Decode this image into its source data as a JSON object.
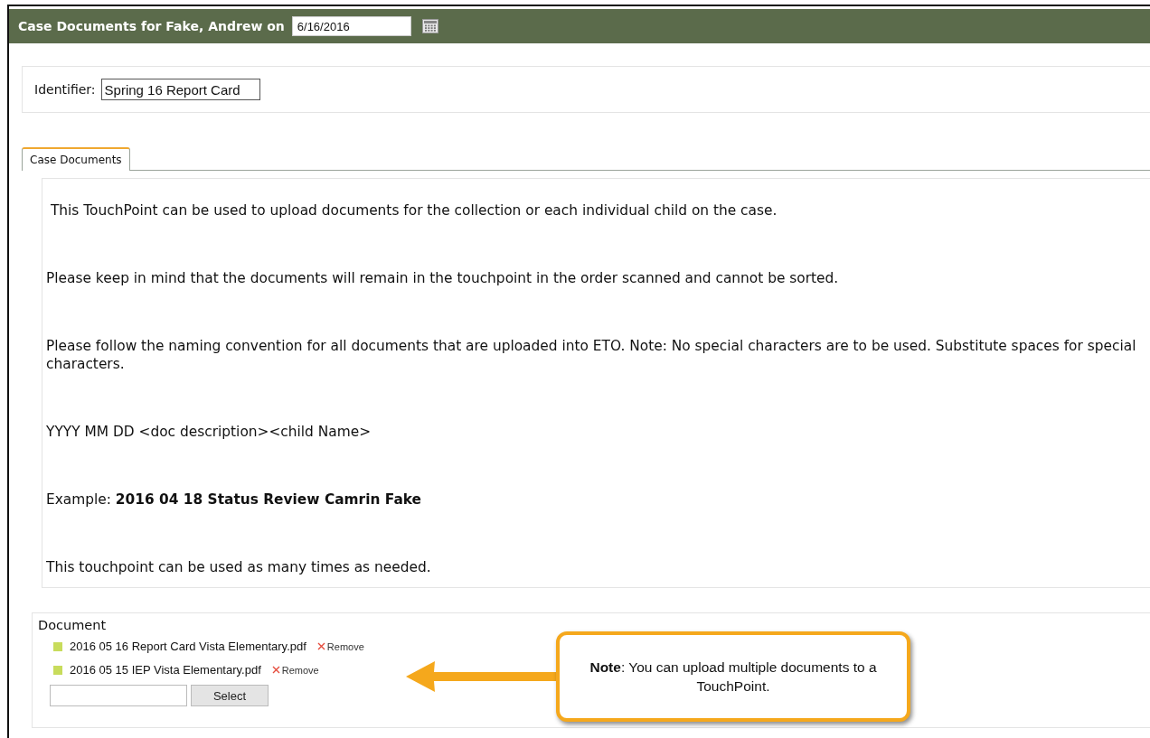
{
  "header": {
    "title": "Case Documents for Fake, Andrew on",
    "date": "6/16/2016"
  },
  "identifier": {
    "label": "Identifier:",
    "value": "Spring 16 Report Card"
  },
  "tabs": [
    {
      "label": "Case Documents",
      "selected": true
    }
  ],
  "paragraphs": [
    " This TouchPoint can be used to upload documents for the collection or each individual child on the case.",
    "Please keep in mind that the documents will remain in the touchpoint in the order scanned and cannot be sorted.",
    "Please follow the naming convention for all documents that are uploaded into ETO. Note: No special characters are to be used. Substitute spaces for special characters.",
    "YYYY MM DD <doc description><child Name>",
    "Example: **2016 04 18 Status Review Camrin Fake**",
    "This touchpoint can be used as many times as needed."
  ],
  "document": {
    "label": "Document",
    "files": [
      {
        "name": "2016 05 16 Report Card Vista Elementary.pdf",
        "remove": "Remove"
      },
      {
        "name": "2016 05 15 IEP Vista Elementary.pdf",
        "remove": "Remove"
      }
    ],
    "select_button": "Select"
  },
  "callout": {
    "text": "**Note**: You can upload multiple documents to a TouchPoint."
  }
}
